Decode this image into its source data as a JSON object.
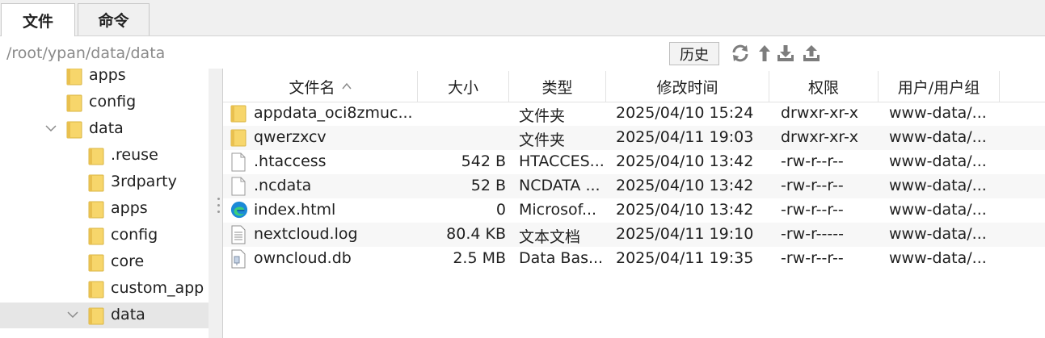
{
  "tabs": [
    {
      "label": "文件",
      "active": true
    },
    {
      "label": "命令",
      "active": false
    }
  ],
  "path": {
    "value": "/root/ypan/data/data"
  },
  "toolbar": {
    "history_label": "历史",
    "icons": [
      "refresh-icon",
      "up-arrow-icon",
      "download-icon",
      "upload-icon"
    ]
  },
  "tree": {
    "items": [
      {
        "label": "apps",
        "level": 1,
        "expanded": null,
        "selected": false
      },
      {
        "label": "config",
        "level": 1,
        "expanded": null,
        "selected": false
      },
      {
        "label": "data",
        "level": 1,
        "expanded": true,
        "selected": false
      },
      {
        "label": ".reuse",
        "level": 2,
        "expanded": null,
        "selected": false
      },
      {
        "label": "3rdparty",
        "level": 2,
        "expanded": null,
        "selected": false
      },
      {
        "label": "apps",
        "level": 2,
        "expanded": null,
        "selected": false
      },
      {
        "label": "config",
        "level": 2,
        "expanded": null,
        "selected": false
      },
      {
        "label": "core",
        "level": 2,
        "expanded": null,
        "selected": false
      },
      {
        "label": "custom_app",
        "level": 2,
        "expanded": null,
        "selected": false
      },
      {
        "label": "data",
        "level": 2,
        "expanded": true,
        "selected": true
      }
    ]
  },
  "filelist": {
    "columns": [
      "文件名",
      "大小",
      "类型",
      "修改时间",
      "权限",
      "用户/用户组"
    ],
    "sort_column": "文件名",
    "rows": [
      {
        "icon": "folder-icon",
        "name": "appdata_oci8zmuc...",
        "size": "",
        "type": "文件夹",
        "modified": "2025/04/10 15:24",
        "perm": "drwxr-xr-x",
        "owner": "www-data/..."
      },
      {
        "icon": "folder-icon",
        "name": "qwerzxcv",
        "size": "",
        "type": "文件夹",
        "modified": "2025/04/11 19:03",
        "perm": "drwxr-xr-x",
        "owner": "www-data/..."
      },
      {
        "icon": "file-icon",
        "name": ".htaccess",
        "size": "542 B",
        "type": "HTACCES...",
        "modified": "2025/04/10 13:42",
        "perm": "-rw-r--r--",
        "owner": "www-data/..."
      },
      {
        "icon": "file-icon",
        "name": ".ncdata",
        "size": "52 B",
        "type": "NCDATA ...",
        "modified": "2025/04/10 13:42",
        "perm": "-rw-r--r--",
        "owner": "www-data/..."
      },
      {
        "icon": "edge-browser-icon",
        "name": "index.html",
        "size": "0",
        "type": "Microsof...",
        "modified": "2025/04/10 13:42",
        "perm": "-rw-r--r--",
        "owner": "www-data/..."
      },
      {
        "icon": "text-file-icon",
        "name": "nextcloud.log",
        "size": "80.4 KB",
        "type": "文本文档",
        "modified": "2025/04/11 19:10",
        "perm": "-rw-r-----",
        "owner": "www-data/..."
      },
      {
        "icon": "database-file-icon",
        "name": "owncloud.db",
        "size": "2.5 MB",
        "type": "Data Bas...",
        "modified": "2025/04/11 19:35",
        "perm": "-rw-r--r--",
        "owner": "www-data/..."
      }
    ]
  },
  "colors": {
    "folder": "#f7d66b",
    "selected_row": "#e6e6e6",
    "alt_row": "#f7f7f7",
    "tool_icon": "#7d7d7d"
  }
}
